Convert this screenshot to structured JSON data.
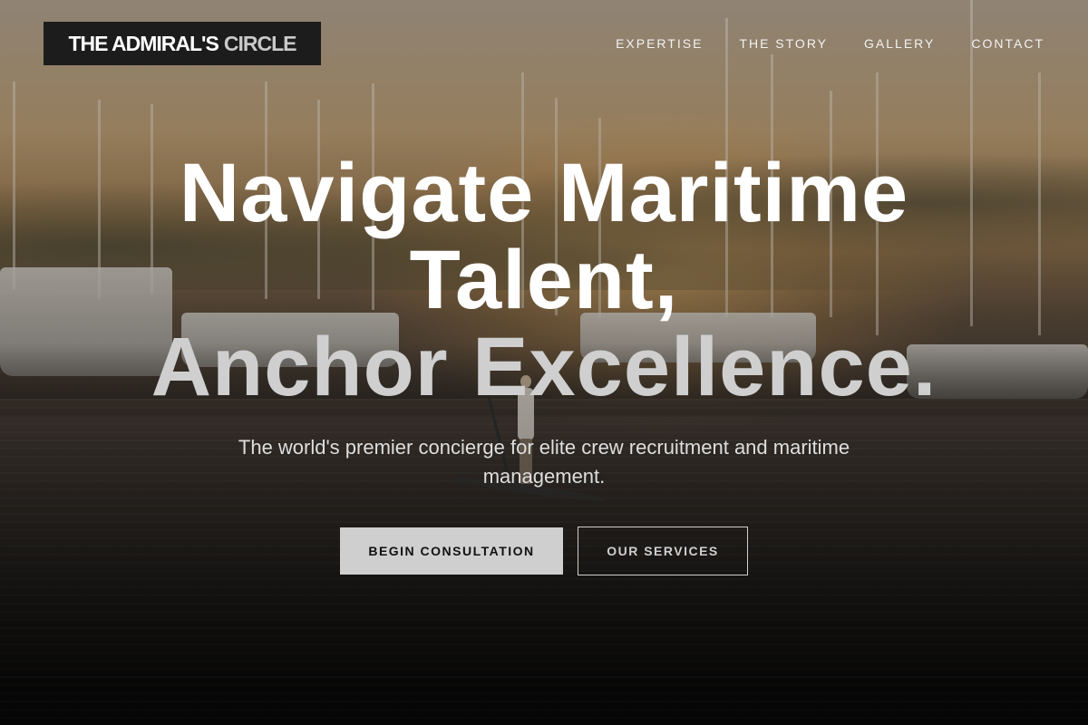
{
  "brand": {
    "name_primary": "THE ADMIRAL'S",
    "name_secondary": "CIRCLE"
  },
  "nav": {
    "items": [
      {
        "label": "EXPERTISE"
      },
      {
        "label": "THE STORY"
      },
      {
        "label": "GALLERY"
      },
      {
        "label": "CONTACT"
      }
    ]
  },
  "hero": {
    "headline_line1": "Navigate Maritime",
    "headline_line2": "Talent,",
    "headline_line3": "Anchor Excellence.",
    "subheading": "The world's premier concierge for elite crew recruitment and maritime management.",
    "primary_cta": "BEGIN CONSULTATION",
    "secondary_cta": "OUR SERVICES",
    "background_image": "marina at sunset with sailboats and a paddleboarder"
  },
  "colors": {
    "logo_background": "#1c1c1c",
    "primary_button": "#cfcfcf",
    "text_light": "#ffffff"
  }
}
